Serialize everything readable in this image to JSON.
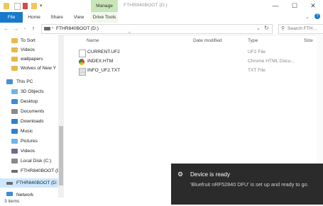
{
  "titlebar": {
    "manage_label": "Manage",
    "window_title": "FTHR840BOOT (D:)",
    "minimize": "—",
    "maximize": "☐",
    "close": "✕"
  },
  "ribbon": {
    "tabs": [
      {
        "label": "File"
      },
      {
        "label": "Home"
      },
      {
        "label": "Share"
      },
      {
        "label": "View"
      },
      {
        "label": "Drive Tools"
      }
    ]
  },
  "address": {
    "path_icon": "drive-icon",
    "path": "FTHR840BOOT (D:)",
    "search_placeholder": "Search FTH..."
  },
  "nav": {
    "items": [
      {
        "label": "To Sort",
        "icon": "folder-icon",
        "color": "#e8b84a"
      },
      {
        "label": "Videos",
        "icon": "folder-icon",
        "color": "#e8b84a"
      },
      {
        "label": "wallpapers",
        "icon": "folder-icon",
        "color": "#e8b84a"
      },
      {
        "label": "Wolves of New Y",
        "icon": "folder-icon",
        "color": "#e8b84a"
      },
      {
        "label": "This PC",
        "icon": "pc-icon",
        "color": "#4a8fd6"
      },
      {
        "label": "3D Objects",
        "icon": "cube-icon",
        "color": "#6fb3e8"
      },
      {
        "label": "Desktop",
        "icon": "desktop-icon",
        "color": "#3c8ad8"
      },
      {
        "label": "Documents",
        "icon": "documents-icon",
        "color": "#8a8a8a"
      },
      {
        "label": "Downloads",
        "icon": "download-icon",
        "color": "#2d7fd3"
      },
      {
        "label": "Music",
        "icon": "music-icon",
        "color": "#2d7fd3"
      },
      {
        "label": "Pictures",
        "icon": "pictures-icon",
        "color": "#6fb3e8"
      },
      {
        "label": "Videos",
        "icon": "videos-icon",
        "color": "#6c6c8c"
      },
      {
        "label": "Local Disk (C:)",
        "icon": "disk-icon",
        "color": "#8a8a8a"
      },
      {
        "label": "FTHR840BOOT (D",
        "icon": "usb-icon",
        "color": "#6a6a6a"
      },
      {
        "label": "FTHR840BOOT (D:",
        "icon": "usb-icon",
        "color": "#6a6a6a"
      },
      {
        "label": "Network",
        "icon": "network-icon",
        "color": "#3c8ad8"
      }
    ]
  },
  "columns": {
    "name": "Name",
    "date": "Date modified",
    "type": "Type",
    "size": "Size"
  },
  "files": [
    {
      "name": "CURRENT.UF2",
      "type": "UF2 File",
      "icon": "file-icon"
    },
    {
      "name": "INDEX.HTM",
      "type": "Chrome HTML Docu...",
      "icon": "chrome-icon"
    },
    {
      "name": "INFO_UF2.TXT",
      "type": "TXT File",
      "icon": "text-file-icon"
    }
  ],
  "status": {
    "items_count": "3 items"
  },
  "toast": {
    "title": "Device is ready",
    "body": "'Bluefruit nRF52840 DFU' is set up and ready to go."
  }
}
